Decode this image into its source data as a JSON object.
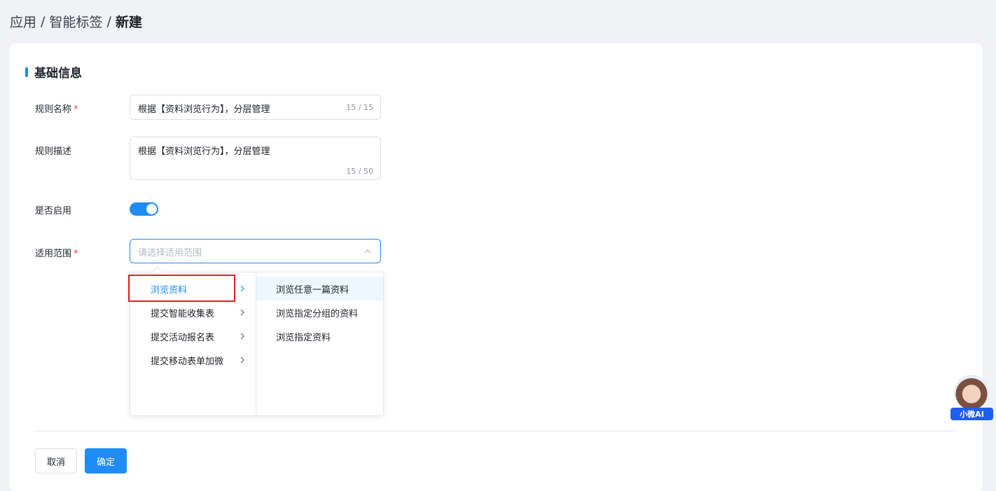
{
  "breadcrumb": {
    "item1": "应用",
    "item2": "智能标签",
    "current": "新建",
    "sep": "/"
  },
  "section": {
    "title": "基础信息"
  },
  "form": {
    "name": {
      "label": "规则名称",
      "required": "*",
      "value": "根据【资料浏览行为】，分层管理",
      "count": "15 / 15"
    },
    "desc": {
      "label": "规则描述",
      "value": "根据【资料浏览行为】，分层管理",
      "count": "15 / 50"
    },
    "enabled": {
      "label": "是否启用",
      "on": true
    },
    "scope": {
      "label": "适用范围",
      "required": "*",
      "placeholder": "请选择适用范围"
    }
  },
  "cascader": {
    "level1": [
      "浏览资料",
      "提交智能收集表",
      "提交活动报名表",
      "提交移动表单加微"
    ],
    "level2": [
      "浏览任意一篇资料",
      "浏览指定分组的资料",
      "浏览指定资料"
    ]
  },
  "buttons": {
    "cancel": "取消",
    "ok": "确定"
  },
  "assistant": {
    "label": "小微AI"
  },
  "colors": {
    "accent": "#1e8cf4",
    "required": "#f53f3f",
    "highlight": "#e02020"
  }
}
